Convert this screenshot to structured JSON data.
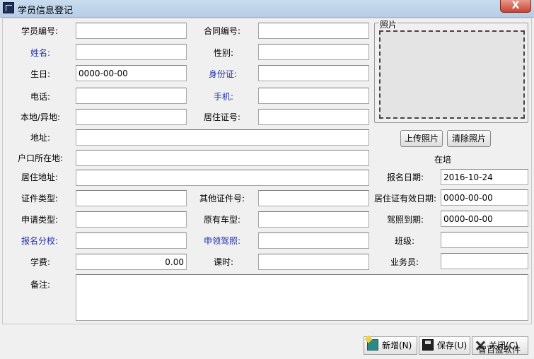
{
  "window": {
    "title": "学员信息登记",
    "close_glyph": "X",
    "app_icon": "app-icon"
  },
  "labels": {
    "student_no": "学员编号:",
    "contract_no": "合同编号:",
    "name": "姓名:",
    "gender": "性别:",
    "birthday": "生日:",
    "id_card": "身份证:",
    "phone": "电话:",
    "mobile": "手机:",
    "local_other": "本地/异地:",
    "residence_permit_no": "居住证号:",
    "address": "地址:",
    "hukou_location": "户口所在地:",
    "residence_address": "居住地址:",
    "signup_date": "报名日期:",
    "cert_type": "证件类型:",
    "other_cert_no": "其他证件号:",
    "residence_expiry": "居住证有效日期:",
    "apply_type": "申请类型:",
    "original_vehicle": "原有车型:",
    "license_expiry": "驾照到期:",
    "branch": "报名分校:",
    "license_claim": "申领驾照:",
    "class": "班级:",
    "tuition": "学费:",
    "class_hours": "课时:",
    "salesperson": "业务员:",
    "remarks": "备注:"
  },
  "values": {
    "student_no": "",
    "contract_no": "",
    "name": "",
    "gender": "",
    "birthday": "0000-00-00",
    "id_card": "",
    "phone": "",
    "mobile": "",
    "local_other": "",
    "residence_permit_no": "",
    "address": "",
    "hukou_location": "",
    "residence_address": "",
    "signup_date": "2016-10-24",
    "cert_type": "",
    "other_cert_no": "",
    "residence_expiry": "0000-00-00",
    "apply_type": "",
    "original_vehicle": "",
    "license_expiry": "0000-00-00",
    "branch": "",
    "license_claim": "",
    "class": "",
    "tuition": "0.00",
    "class_hours": "",
    "salesperson": "",
    "remarks": ""
  },
  "photo": {
    "legend": "照片",
    "upload_label": "上传照片",
    "clear_label": "清除照片",
    "status": "在培"
  },
  "toolbar": {
    "new_label": "新增(N)",
    "save_label": "保存(U)",
    "close_label": "关闭(C)"
  },
  "watermark": "智百盈软件",
  "colors": {
    "required_label": "#1f2fa6",
    "titlebar": "#c9dcef",
    "close_button": "#c7452f"
  }
}
